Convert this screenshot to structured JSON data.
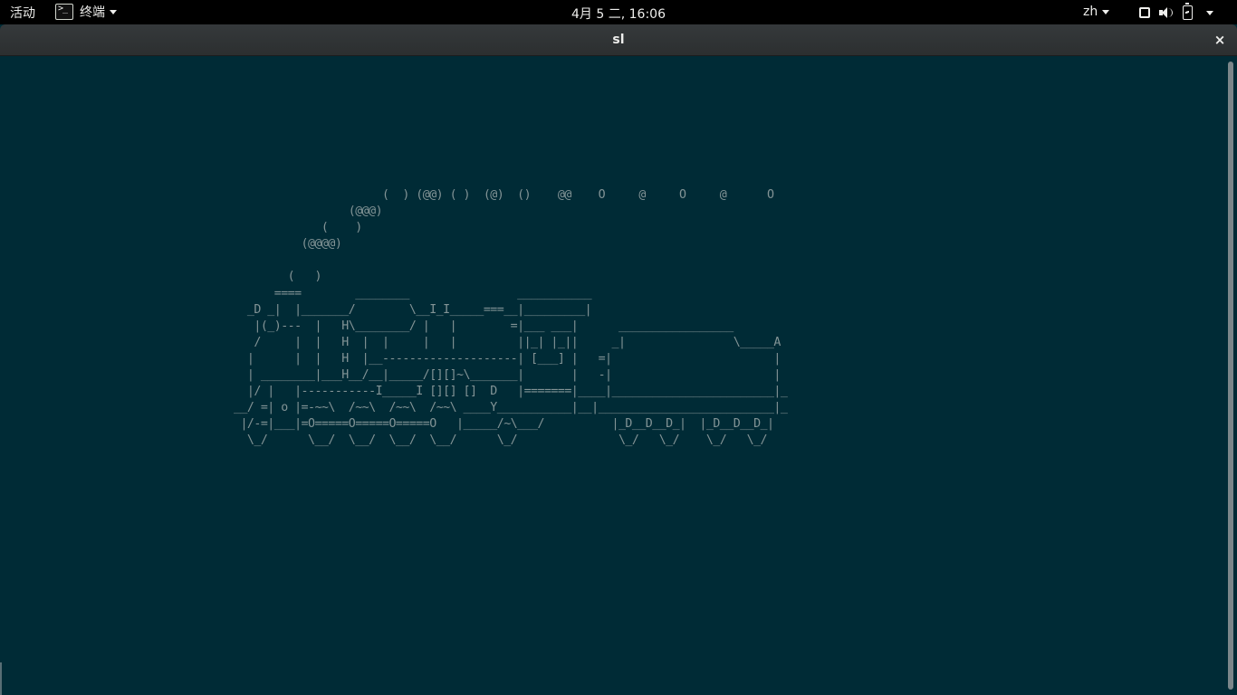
{
  "topbar": {
    "activities_label": "活动",
    "app_menu": {
      "icon": "terminal-icon",
      "label": "终端"
    },
    "clock": "4月 5 二, 16:06",
    "input_language": "zh",
    "system_icons": [
      "display-icon",
      "volume-icon",
      "battery-icon"
    ]
  },
  "window": {
    "title": "sl",
    "close_label": "×"
  },
  "terminal": {
    "background": "#002b36",
    "foreground": "#839496",
    "ascii_art": "                      (  ) (@@) ( )  (@)  ()    @@    O     @     O     @      O\n                 (@@@)\n             (    )\n          (@@@@)\n\n        (   )\n      ====        ________                ___________\n  _D _|  |_______/        \\__I_I_____===__|_________|\n   |(_)---  |   H\\________/ |   |        =|___ ___|      _________________\n   /     |  |   H  |  |     |   |         ||_| |_||     _|                \\_____A\n  |      |  |   H  |__--------------------| [___] |   =|                        |\n  | ________|___H__/__|_____/[][]~\\_______|       |   -|                        |\n  |/ |   |-----------I_____I [][] []  D   |=======|____|________________________|_\n__/ =| o |=-~~\\  /~~\\  /~~\\  /~~\\ ____Y___________|__|__________________________|_\n |/-=|___|=O=====O=====O=====O   |_____/~\\___/          |_D__D__D_|  |_D__D__D_|\n  \\_/      \\__/  \\__/  \\__/  \\__/      \\_/               \\_/   \\_/    \\_/   \\_/"
  }
}
